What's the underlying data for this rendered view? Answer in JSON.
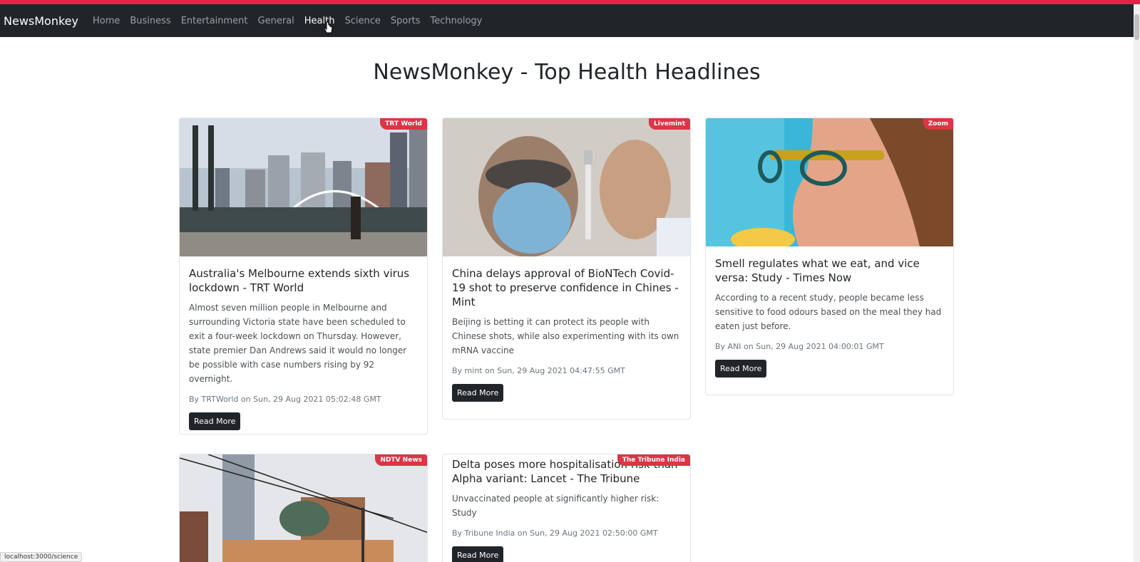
{
  "nav": {
    "brand": "NewsMonkey",
    "links": [
      "Home",
      "Business",
      "Entertainment",
      "General",
      "Health",
      "Science",
      "Sports",
      "Technology"
    ]
  },
  "page": {
    "title": "NewsMonkey - Top Health Headlines"
  },
  "cards": [
    {
      "source": "TRT World",
      "title": "Australia's Melbourne extends sixth virus lockdown - TRT World",
      "description": "Almost seven million people in Melbourne and surrounding Victoria state have been scheduled to exit a four-week lockdown on Thursday. However, state premier Dan Andrews said it would no longer be possible with case numbers rising by 92 overnight.",
      "meta": "By TRTWorld on Sun, 29 Aug 2021 05:02:48 GMT",
      "button": "Read More"
    },
    {
      "source": "Livemint",
      "title": "China delays approval of BioNTech Covid-19 shot to preserve confidence in Chines - Mint",
      "description": "Beijing is betting it can protect its people with Chinese shots, while also experimenting with its own mRNA vaccine",
      "meta": "By mint on Sun, 29 Aug 2021 04:47:55 GMT",
      "button": "Read More"
    },
    {
      "source": "Zoom",
      "title": "Smell regulates what we eat, and vice versa: Study - Times Now",
      "description": "According to a recent study, people became less sensitive to food odours based on the meal they had eaten just before.",
      "meta": "By ANI on Sun, 29 Aug 2021 04:00:01 GMT",
      "button": "Read More"
    },
    {
      "source": "NDTV News"
    },
    {
      "source": "The Tribune India",
      "title": "Delta poses more hospitalisation risk than Alpha variant: Lancet - The Tribune",
      "description": "Unvaccinated people at significantly higher risk: Study",
      "meta": "By Tribune India on Sun, 29 Aug 2021 02:50:00 GMT",
      "button": "Read More"
    }
  ],
  "status_bar": {
    "url": "localhost:3000/science"
  },
  "colors": {
    "navbar": "#212529",
    "badge": "#dc3545",
    "accent_line": "#e3234a"
  }
}
